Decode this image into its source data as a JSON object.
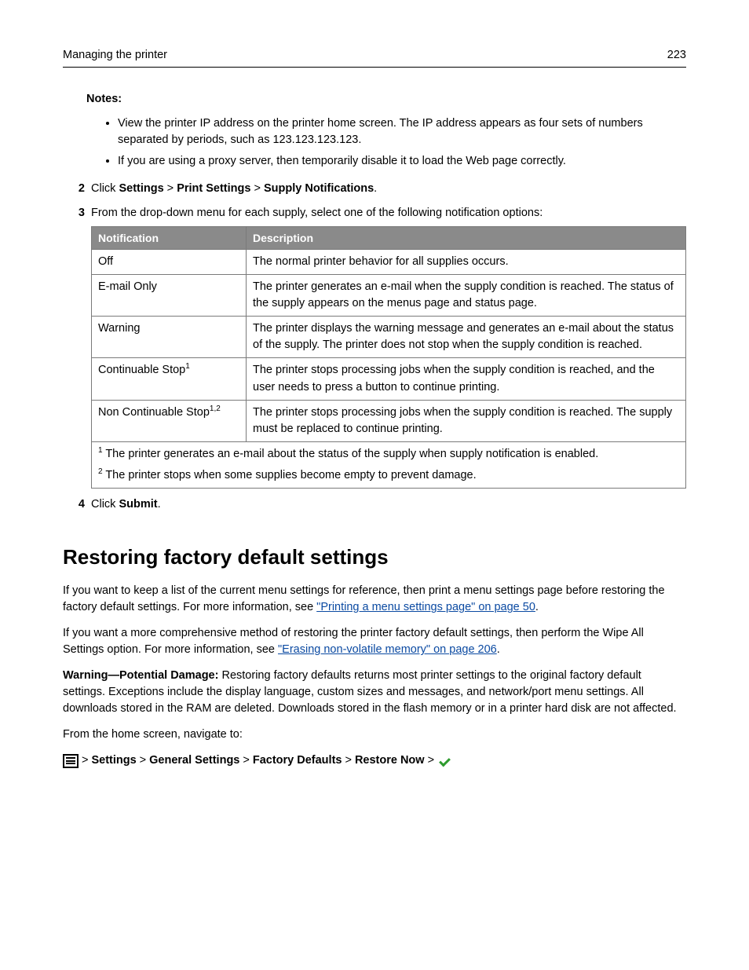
{
  "header": {
    "title": "Managing the printer",
    "page": "223"
  },
  "notes": {
    "label": "Notes:",
    "items": [
      "View the printer IP address on the printer home screen. The IP address appears as four sets of numbers separated by periods, such as 123.123.123.123.",
      "If you are using a proxy server, then temporarily disable it to load the Web page correctly."
    ]
  },
  "step2": {
    "num": "2",
    "click": "Click ",
    "a": "Settings",
    "sep": " > ",
    "b": "Print Settings",
    "c": "Supply Notifications",
    "end": "."
  },
  "step3": {
    "num": "3",
    "text": "From the drop-down menu for each supply, select one of the following notification options:"
  },
  "table": {
    "h1": "Notification",
    "h2": "Description",
    "rows": [
      {
        "n": "Off",
        "d": "The normal printer behavior for all supplies occurs."
      },
      {
        "n": "E-mail Only",
        "d": "The printer generates an e-mail when the supply condition is reached. The status of the supply appears on the menus page and status page."
      },
      {
        "n": "Warning",
        "d": "The printer displays the warning message and generates an e-mail about the status of the supply. The printer does not stop when the supply condition is reached."
      },
      {
        "n": "Continuable Stop",
        "sup": "1",
        "d": "The printer stops processing jobs when the supply condition is reached, and the user needs to press a button to continue printing."
      },
      {
        "n": "Non Continuable Stop",
        "sup": "1,2",
        "d": "The printer stops processing jobs when the supply condition is reached. The supply must be replaced to continue printing."
      }
    ],
    "foot1": " The printer generates an e-mail about the status of the supply when supply notification is enabled.",
    "foot2": " The printer stops when some supplies become empty to prevent damage."
  },
  "step4": {
    "num": "4",
    "click": "Click ",
    "btn": "Submit",
    "end": "."
  },
  "section": {
    "title": "Restoring factory default settings",
    "p1a": "If you want to keep a list of the current menu settings for reference, then print a menu settings page before restoring the factory default settings. For more information, see ",
    "link1": "\"Printing a menu settings page\" on page 50",
    "p1b": ".",
    "p2a": "If you want a more comprehensive method of restoring the printer factory default settings, then perform the Wipe All Settings option. For more information, see ",
    "link2": "\"Erasing non-volatile memory\" on page 206",
    "p2b": ".",
    "warnLabel": "Warning—Potential Damage:",
    "warnText": " Restoring factory defaults returns most printer settings to the original factory default settings. Exceptions include the display language, custom sizes and messages, and network/port menu settings. All downloads stored in the RAM are deleted. Downloads stored in the flash memory or in a printer hard disk are not affected.",
    "navIntro": "From the home screen, navigate to:",
    "nav": {
      "a": "Settings",
      "b": "General Settings",
      "c": "Factory Defaults",
      "d": "Restore Now",
      "sep": " > "
    }
  }
}
